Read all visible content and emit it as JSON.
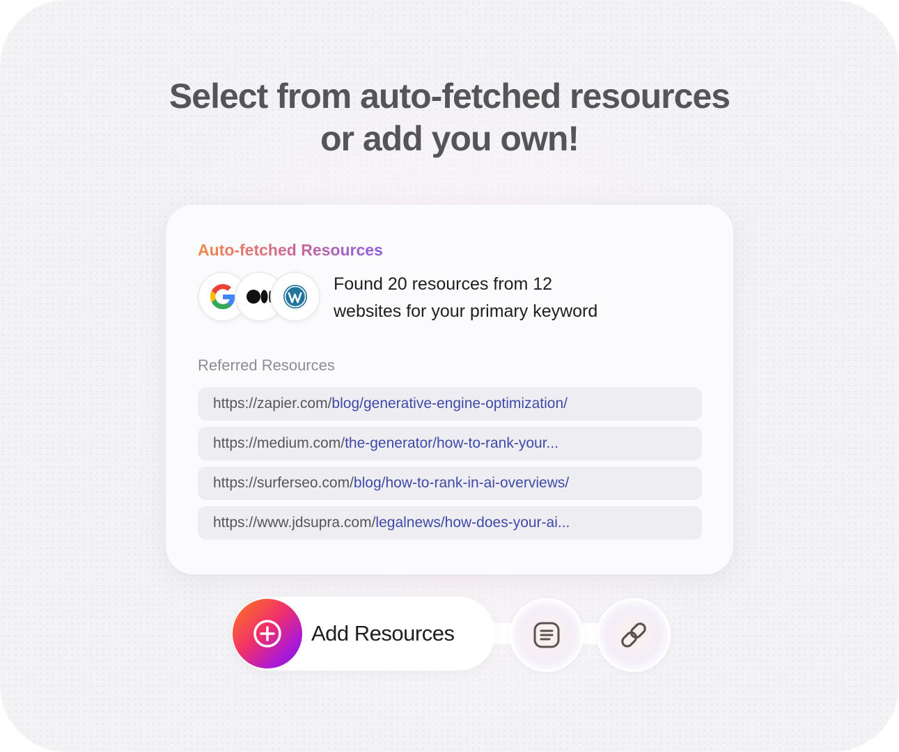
{
  "headline": {
    "line1": "Select from auto-fetched resources",
    "line2": "or add you own!"
  },
  "card": {
    "title": "Auto-fetched Resources",
    "logos": [
      "google-icon",
      "medium-icon",
      "wordpress-icon"
    ],
    "found_line1": "Found 20 resources from 12",
    "found_line2": "websites for your primary keyword",
    "referred_label": "Referred Resources",
    "resources": [
      {
        "host": "https://zapier.com/",
        "path": "blog/generative-engine-optimization/"
      },
      {
        "host": "https://medium.com/",
        "path": "the-generator/how-to-rank-your..."
      },
      {
        "host": "https://surferseo.com/",
        "path": "blog/how-to-rank-in-ai-overviews/"
      },
      {
        "host": "https://www.jdsupra.com/",
        "path": "legalnews/how-does-your-ai..."
      }
    ]
  },
  "actions": {
    "add_label": "Add Resources",
    "add_icon": "plus-circle-icon",
    "doc_icon": "document-icon",
    "link_icon": "link-icon"
  },
  "colors": {
    "title_gradient_start": "#f08a4a",
    "title_gradient_end": "#8a5ee0",
    "link_text": "#3e4aa8",
    "add_button_gradient_start": "#ff7a1a",
    "add_button_gradient_end": "#7a1ae8"
  }
}
